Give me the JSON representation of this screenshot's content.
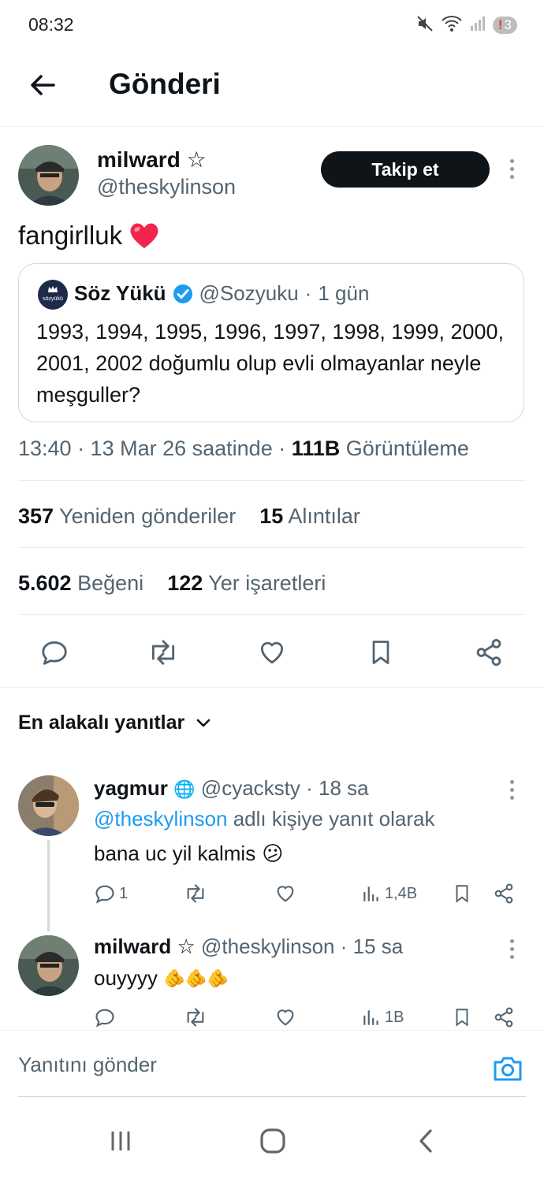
{
  "status_bar": {
    "time": "08:32",
    "notification_count": "3",
    "battery_alert": "!"
  },
  "header": {
    "title": "Gönderi",
    "back_icon": "arrow-left-icon"
  },
  "tweet": {
    "author_name": "milward",
    "author_badge": "☆",
    "author_handle": "@theskylinson",
    "follow_label": "Takip et",
    "text": "fangirlluk",
    "emoji": "❤️",
    "quote": {
      "author_name": "Söz Yükü",
      "avatar_text": "sözyükü",
      "handle": "@Sozyuku",
      "time": "1 gün",
      "separator": "·",
      "text": "1993, 1994, 1995, 1996, 1997, 1998, 1999, 2000, 2001, 2002 doğumlu olup evli olmayanlar neyle meşguller?"
    },
    "meta": {
      "time": "13:40 · 13 Mar 26 saatinde · ",
      "views_count": "111B",
      "views_label": "Görüntüleme"
    },
    "stats": {
      "reposts_count": "357",
      "reposts_label": "Yeniden gönderiler",
      "quotes_count": "15",
      "quotes_label": "Alıntılar",
      "likes_count": "5.602",
      "likes_label": "Beğeni",
      "bookmarks_count": "122",
      "bookmarks_label": "Yer işaretleri"
    }
  },
  "replies_sort": {
    "label": "En alakalı yanıtlar"
  },
  "replies": [
    {
      "name": "yagmur",
      "badge": "🌐",
      "handle": "@cyacksty",
      "time": "· 18 sa",
      "reply_to_handle": "@theskylinson",
      "reply_to_suffix": " adlı kişiye yanıt olarak",
      "text": "bana uc yil kalmis",
      "emoji": "😕",
      "reply_count": "1",
      "repost_count": "",
      "like_count": "",
      "views": "1,4B"
    },
    {
      "name": "milward",
      "badge": "☆",
      "handle": "@theskylinson",
      "time": "· 15 sa",
      "text": "ouyyyy",
      "emoji": "🫵🫵🫵",
      "reply_count": "",
      "repost_count": "",
      "like_count": "",
      "views": "1B"
    }
  ],
  "composer": {
    "placeholder": "Yanıtını gönder"
  },
  "colors": {
    "accent": "#1d9bf0",
    "text": "#0f1419",
    "muted": "#536471",
    "heart": "#f91880"
  }
}
